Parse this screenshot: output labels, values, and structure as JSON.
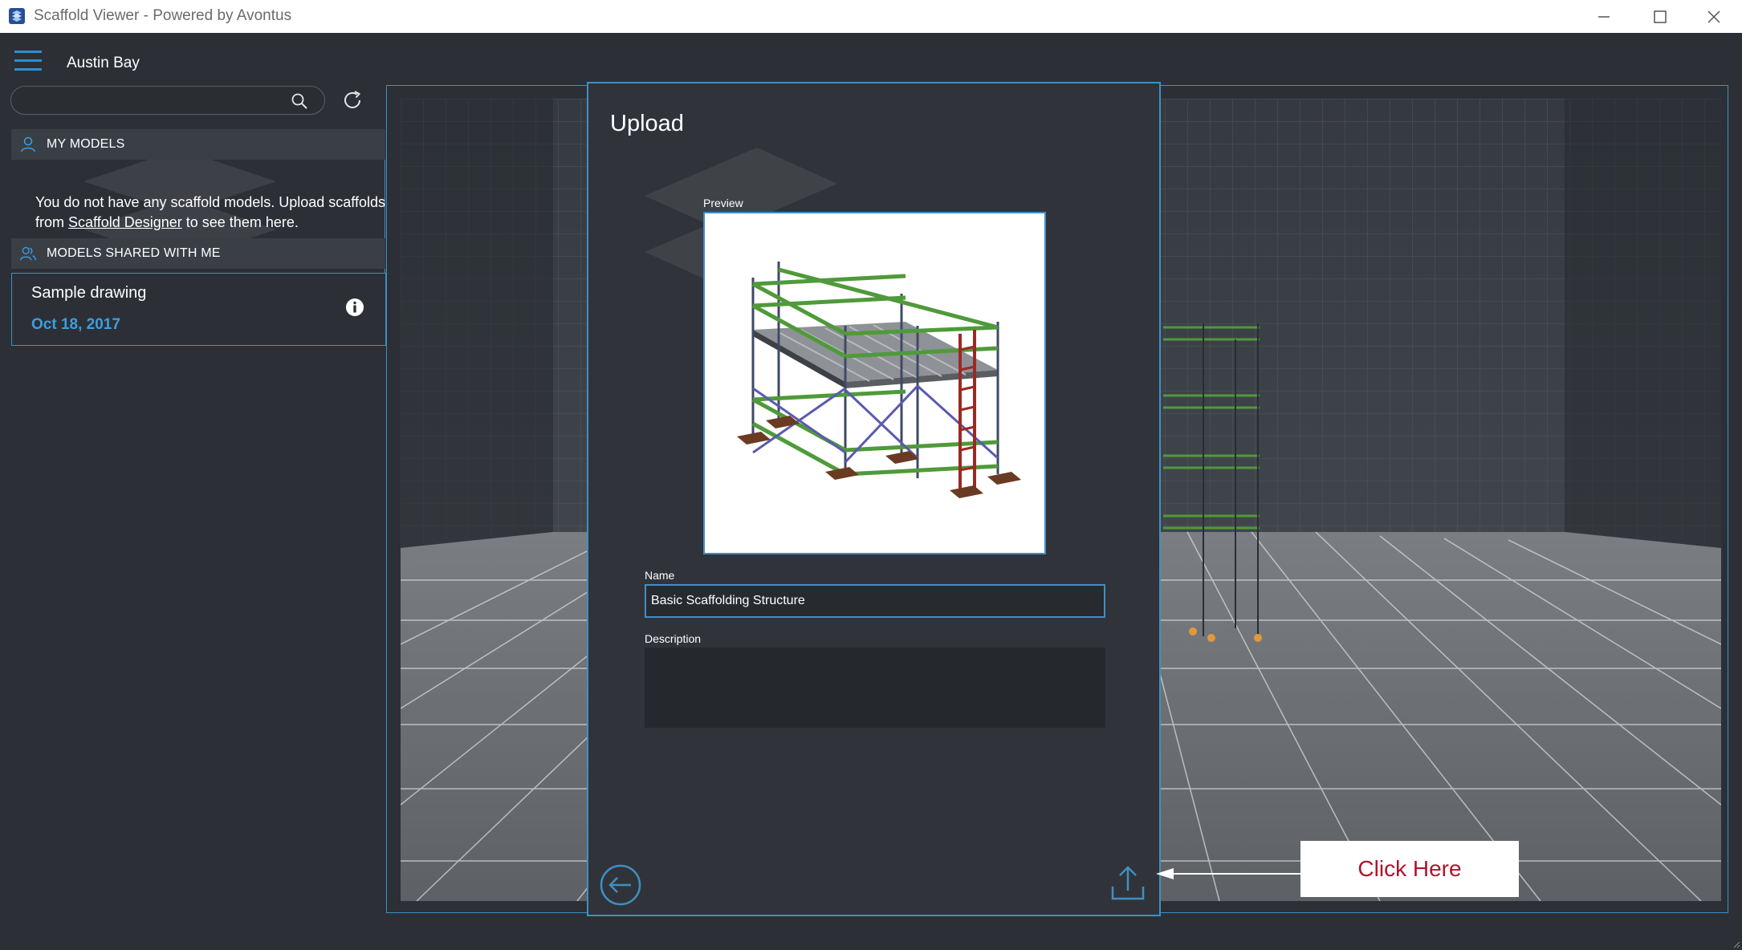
{
  "window": {
    "title": "Scaffold Viewer - Powered by Avontus"
  },
  "header": {
    "username": "Austin Bay"
  },
  "search": {
    "placeholder": "",
    "value": ""
  },
  "sidebar": {
    "my_models": {
      "label": "MY MODELS",
      "empty_text_before": "You do not have any scaffold models. Upload scaffolds from ",
      "empty_link": "Scaffold Designer",
      "empty_text_after": " to see them here."
    },
    "shared": {
      "label": "MODELS SHARED WITH ME",
      "items": [
        {
          "name": "Sample drawing",
          "date": "Oct 18, 2017"
        }
      ]
    }
  },
  "dialog": {
    "title": "Upload",
    "preview_label": "Preview",
    "name_label": "Name",
    "name_value": "Basic Scaffolding Structure",
    "description_label": "Description",
    "description_value": ""
  },
  "callout": {
    "text": "Click Here"
  },
  "colors": {
    "accent": "#3f8fc4",
    "date": "#3c9ee0",
    "callout_text": "#b0132b",
    "background": "#2c3036"
  }
}
